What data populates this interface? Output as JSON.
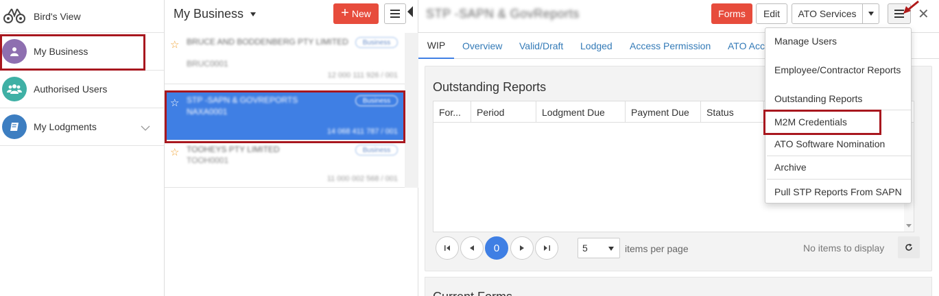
{
  "nav": {
    "items": [
      {
        "label": "Bird's View",
        "icon": "binoculars-icon"
      },
      {
        "label": "My Business",
        "icon": "user-icon",
        "color": "#8e6fb0"
      },
      {
        "label": "Authorised Users",
        "icon": "users-icon",
        "color": "#3fb0a5"
      },
      {
        "label": "My Lodgments",
        "icon": "book-icon",
        "color": "#3d7ec1"
      }
    ]
  },
  "business_list": {
    "title": "My Business",
    "new_label": "New",
    "items": [
      {
        "name": "BRUCE AND BODDENBERG PTY LIMITED",
        "code": "BRUC0001",
        "abn": "12 000 111 926 / 001",
        "badge": "Business"
      },
      {
        "name": "STP -SAPN & GovReports",
        "code": "NAXA0001",
        "abn": "14 068 411 787 / 001",
        "badge": "Business"
      },
      {
        "name": "TOOHEYS PTY LIMITED",
        "code": "TOOH0001",
        "abn": "11 000 002 568 / 001",
        "badge": "Business"
      }
    ]
  },
  "main": {
    "title": "STP -SAPN & GovReports",
    "forms_label": "Forms",
    "edit_label": "Edit",
    "ato_services_label": "ATO Services",
    "tabs": [
      "WIP",
      "Overview",
      "Valid/Draft",
      "Lodged",
      "Access Permission",
      "ATO Acc"
    ],
    "outstanding": {
      "title": "Outstanding Reports",
      "columns": [
        "For...",
        "Period",
        "Lodgment Due",
        "Payment Due",
        "Status"
      ],
      "pager": {
        "current_page": "0",
        "page_size": "5",
        "items_per_page_label": "items per page",
        "no_items_label": "No items to display"
      }
    },
    "current_forms_title": "Current Forms"
  },
  "menu": {
    "items": [
      "Manage Users",
      "Employee/Contractor Reports",
      "Outstanding Reports",
      "M2M Credentials",
      "ATO Software Nomination",
      "Archive",
      "Pull STP Reports From SAPN"
    ]
  },
  "colors": {
    "accent_red": "#e74c3c",
    "highlight_red": "#a8171e",
    "selected_blue": "#3f7fe4",
    "link_blue": "#337ab7"
  }
}
